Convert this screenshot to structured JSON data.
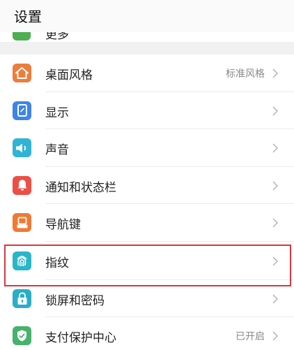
{
  "header": {
    "title": "设置"
  },
  "partial_item": {
    "label": "更多"
  },
  "items": [
    {
      "label": "桌面风格",
      "value": "标准风格",
      "icon": "home-icon",
      "color": "#ee7d3b"
    },
    {
      "label": "显示",
      "value": "",
      "icon": "display-icon",
      "color": "#3d86e6"
    },
    {
      "label": "声音",
      "value": "",
      "icon": "speaker-icon",
      "color": "#2fb3d6"
    },
    {
      "label": "通知和状态栏",
      "value": "",
      "icon": "bell-icon",
      "color": "#ec4f46"
    },
    {
      "label": "导航键",
      "value": "",
      "icon": "navigation-keys-icon",
      "color": "#f07a33"
    },
    {
      "label": "指纹",
      "value": "",
      "icon": "fingerprint-icon",
      "color": "#29b6c8"
    },
    {
      "label": "锁屏和密码",
      "value": "",
      "icon": "lock-icon",
      "color": "#2aaec7"
    },
    {
      "label": "支付保护中心",
      "value": "已开启",
      "icon": "shield-check-icon",
      "color": "#45b36b"
    }
  ],
  "colors": {
    "highlight": "#d9363e",
    "chevron": "#b5b5b5"
  }
}
